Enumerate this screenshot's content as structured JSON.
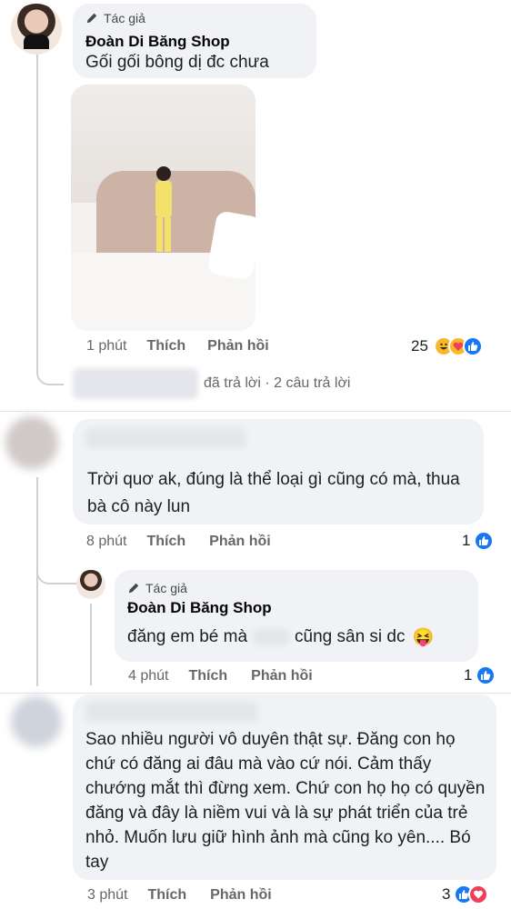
{
  "comment1": {
    "author_badge": "Tác giả",
    "author_name": "Đoàn Di Băng Shop",
    "text": "Gối gối bông dị đc chưa",
    "time": "1 phút",
    "like_label": "Thích",
    "reply_label": "Phản hồi",
    "reaction_count": "25",
    "reactions": [
      "haha-icon",
      "care-icon",
      "like-icon"
    ]
  },
  "replies_summary": {
    "text": "đã trả lời · 2 câu trả lời"
  },
  "comment2": {
    "text": "Trời quơ ak, đúng là thể loại gì cũng có mà, thua bà cô này lun",
    "time": "8 phút",
    "like_label": "Thích",
    "reply_label": "Phản hồi",
    "reaction_count": "1",
    "reactions": [
      "like-icon"
    ]
  },
  "reply1": {
    "author_badge": "Tác giả",
    "author_name": "Đoàn Di Băng Shop",
    "text_before": "đăng em bé mà",
    "text_after": "cũng sân si dc",
    "emoji": "😝",
    "time": "4 phút",
    "like_label": "Thích",
    "reply_label": "Phản hồi",
    "reaction_count": "1",
    "reactions": [
      "like-icon"
    ]
  },
  "comment3": {
    "text": "Sao nhiều người vô duyên thật sự. Đăng con họ chứ có đăng ai đâu mà vào cứ nói. Cảm thấy chướng mắt thì đừng xem. Chứ con họ họ có quyền đăng và đây là niềm vui và là sự phát triển của trẻ nhỏ. Muốn lưu giữ hình ảnh mà cũng ko yên.... Bó tay",
    "time": "3 phút",
    "like_label": "Thích",
    "reply_label": "Phản hồi",
    "reaction_count": "3",
    "reactions": [
      "like-icon",
      "love-icon"
    ]
  },
  "colors": {
    "bubble": "#f0f2f5",
    "meta": "#65676b",
    "like_blue": "#1877f2"
  }
}
